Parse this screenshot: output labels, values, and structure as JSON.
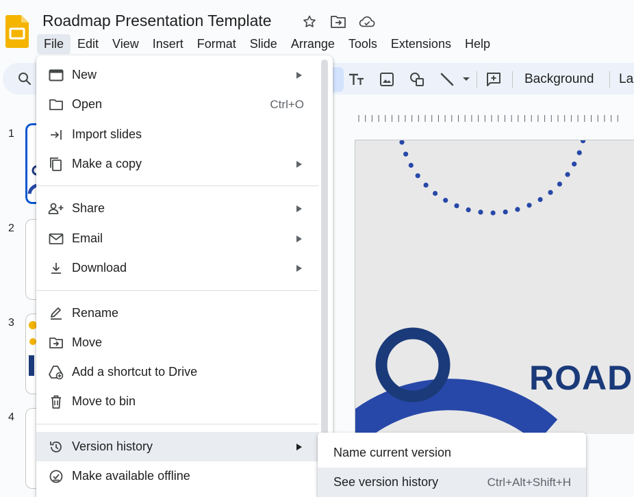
{
  "document": {
    "title": "Roadmap Presentation Template"
  },
  "menubar": {
    "items": [
      "File",
      "Edit",
      "View",
      "Insert",
      "Format",
      "Slide",
      "Arrange",
      "Tools",
      "Extensions",
      "Help"
    ],
    "active": "File"
  },
  "toolbar": {
    "background_label": "Background",
    "layout_label_partial": "La"
  },
  "filmstrip": {
    "slide_numbers": [
      "1",
      "2",
      "3",
      "4"
    ],
    "selected": "1"
  },
  "slide": {
    "title_text": "ROAD"
  },
  "file_menu": {
    "items": [
      {
        "label": "New",
        "icon": "new-slides-icon",
        "submenu": true
      },
      {
        "label": "Open",
        "icon": "folder-icon",
        "shortcut": "Ctrl+O"
      },
      {
        "label": "Import slides",
        "icon": "import-icon"
      },
      {
        "label": "Make a copy",
        "icon": "copy-icon",
        "submenu": true
      },
      {
        "label": "Share",
        "icon": "person-add-icon",
        "submenu": true
      },
      {
        "label": "Email",
        "icon": "mail-icon",
        "submenu": true
      },
      {
        "label": "Download",
        "icon": "download-icon",
        "submenu": true
      },
      {
        "label": "Rename",
        "icon": "rename-icon"
      },
      {
        "label": "Move",
        "icon": "move-folder-icon"
      },
      {
        "label": "Add a shortcut to Drive",
        "icon": "drive-shortcut-icon"
      },
      {
        "label": "Move to bin",
        "icon": "trash-icon"
      },
      {
        "label": "Version history",
        "icon": "history-icon",
        "submenu": true,
        "hover": true
      },
      {
        "label": "Make available offline",
        "icon": "offline-icon"
      }
    ]
  },
  "version_submenu": {
    "items": [
      {
        "label": "Name current version"
      },
      {
        "label": "See version history",
        "shortcut": "Ctrl+Alt+Shift+H",
        "hover": true
      }
    ]
  },
  "colors": {
    "accent": "#0b57d0",
    "toolbar_bg": "#edf2fa",
    "menu_hover": "#e9ecf1",
    "slide_navy": "#1b3a7a",
    "slide_blue": "#2748a8",
    "logo_yellow": "#f4b400"
  }
}
